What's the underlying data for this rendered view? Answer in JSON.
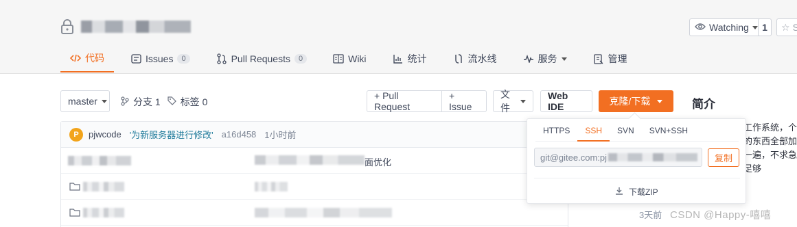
{
  "header": {
    "watch_label": "Watching",
    "watch_count": "1",
    "star_label": "St"
  },
  "tabs": [
    {
      "label": "代码",
      "icon": "code-icon",
      "active": true
    },
    {
      "label": "Issues",
      "badge": "0",
      "icon": "issues-icon"
    },
    {
      "label": "Pull Requests",
      "badge": "0",
      "icon": "pull-request-icon"
    },
    {
      "label": "Wiki",
      "icon": "wiki-icon"
    },
    {
      "label": "统计",
      "icon": "chart-icon"
    },
    {
      "label": "流水线",
      "icon": "pipeline-icon"
    },
    {
      "label": "服务",
      "icon": "service-icon"
    },
    {
      "label": "管理",
      "icon": "manage-icon"
    }
  ],
  "toolbar": {
    "branch": "master",
    "branches": "分支 1",
    "tags": "标签 0",
    "pull_request": "+ Pull Request",
    "issue": "+ Issue",
    "file": "文件",
    "web_ide": "Web IDE",
    "clone": "克隆/下载"
  },
  "intro": {
    "title": "简介",
    "lines": [
      "工作系统，个",
      "的东西全部加",
      "一遍，不求急",
      "足够"
    ]
  },
  "commit": {
    "avatar": "P",
    "author": "pjwcode",
    "message": "'为新服务器进行修改'",
    "hash": "a16d458",
    "time": "1小时前"
  },
  "files": {
    "row1_fragment": "面优化",
    "last_updated": "3天前"
  },
  "clone_panel": {
    "protocols": [
      "HTTPS",
      "SSH",
      "SVN",
      "SVN+SSH"
    ],
    "active_protocol": "SSH",
    "url": "git@gitee.com:pj",
    "copy": "复制",
    "download_zip": "下载ZIP"
  },
  "watermark": "CSDN @Happy-嘻嘻",
  "colors": {
    "accent": "#f26f22",
    "commit_link": "#1e7a9a"
  }
}
